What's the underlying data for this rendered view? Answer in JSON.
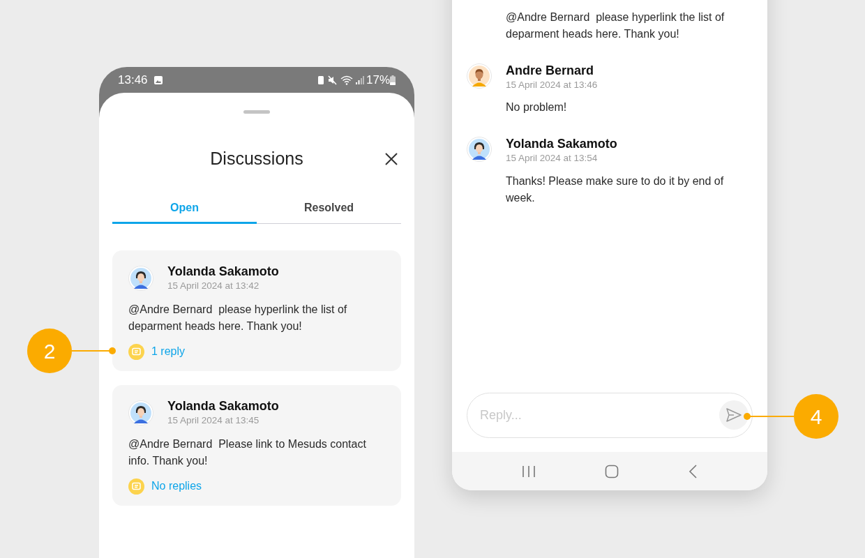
{
  "left_phone": {
    "status_bar": {
      "time": "13:46",
      "battery": "17%"
    },
    "sheet": {
      "title": "Discussions",
      "tabs": [
        {
          "label": "Open",
          "selected": true
        },
        {
          "label": "Resolved",
          "selected": false
        }
      ],
      "threads": [
        {
          "author": "Yolanda Sakamoto",
          "kind": "woman",
          "timestamp": "15 April 2024 at 13:42",
          "text": "@Andre Bernard  please hyperlink the list of deparment heads here. Thank you!",
          "replies": "1 reply"
        },
        {
          "author": "Yolanda Sakamoto",
          "kind": "woman",
          "timestamp": "15 April 2024 at 13:45",
          "text": "@Andre Bernard  Please link to Mesuds contact info. Thank you!",
          "replies": "No replies"
        }
      ]
    }
  },
  "right_phone": {
    "comments": [
      {
        "text": "@Andre Bernard  please hyperlink the list of deparment heads here. Thank you!"
      },
      {
        "author": "Andre Bernard",
        "kind": "man",
        "timestamp": "15 April 2024 at 13:46",
        "text": "No problem!"
      },
      {
        "author": "Yolanda Sakamoto",
        "kind": "woman",
        "timestamp": "15 April 2024 at 13:54",
        "text": "Thanks! Please make sure to do it by end of week."
      }
    ],
    "reply_field": {
      "placeholder": "Reply..."
    }
  },
  "callouts": [
    {
      "number": "2"
    },
    {
      "number": "4"
    }
  ]
}
